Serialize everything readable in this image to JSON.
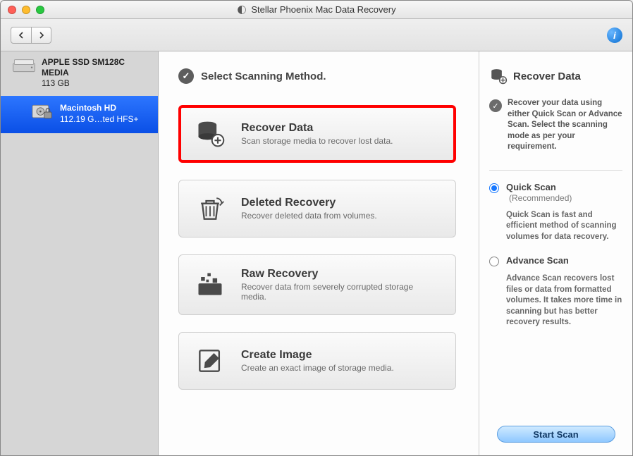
{
  "window": {
    "title": "Stellar Phoenix Mac Data Recovery"
  },
  "toolbar": {
    "info_tooltip": "i"
  },
  "sidebar": {
    "drive": {
      "name": "APPLE SSD SM128C MEDIA",
      "size": "113  GB"
    },
    "volume": {
      "name": "Macintosh HD",
      "detail": "112.19 G…ted HFS+"
    }
  },
  "main": {
    "section_title": "Select Scanning Method.",
    "cards": [
      {
        "key": "recover",
        "title": "Recover Data",
        "desc": "Scan storage media to recover lost data.",
        "highlight": true
      },
      {
        "key": "deleted",
        "title": "Deleted Recovery",
        "desc": "Recover deleted data from volumes."
      },
      {
        "key": "raw",
        "title": "Raw Recovery",
        "desc": "Recover data from severely corrupted storage media."
      },
      {
        "key": "image",
        "title": "Create Image",
        "desc": "Create an exact image of storage media."
      }
    ]
  },
  "right": {
    "title": "Recover Data",
    "note": "Recover your data using either Quick Scan or Advance Scan. Select the scanning mode as per your requirement.",
    "options": [
      {
        "key": "quick",
        "label": "Quick Scan",
        "hint": "(Recommended)",
        "desc": "Quick Scan is fast and efficient method of scanning volumes for data recovery.",
        "selected": true
      },
      {
        "key": "advance",
        "label": "Advance Scan",
        "hint": "",
        "desc": "Advance Scan recovers lost files or data from formatted volumes. It takes more time in scanning but has better recovery results.",
        "selected": false
      }
    ],
    "start_label": "Start Scan"
  }
}
